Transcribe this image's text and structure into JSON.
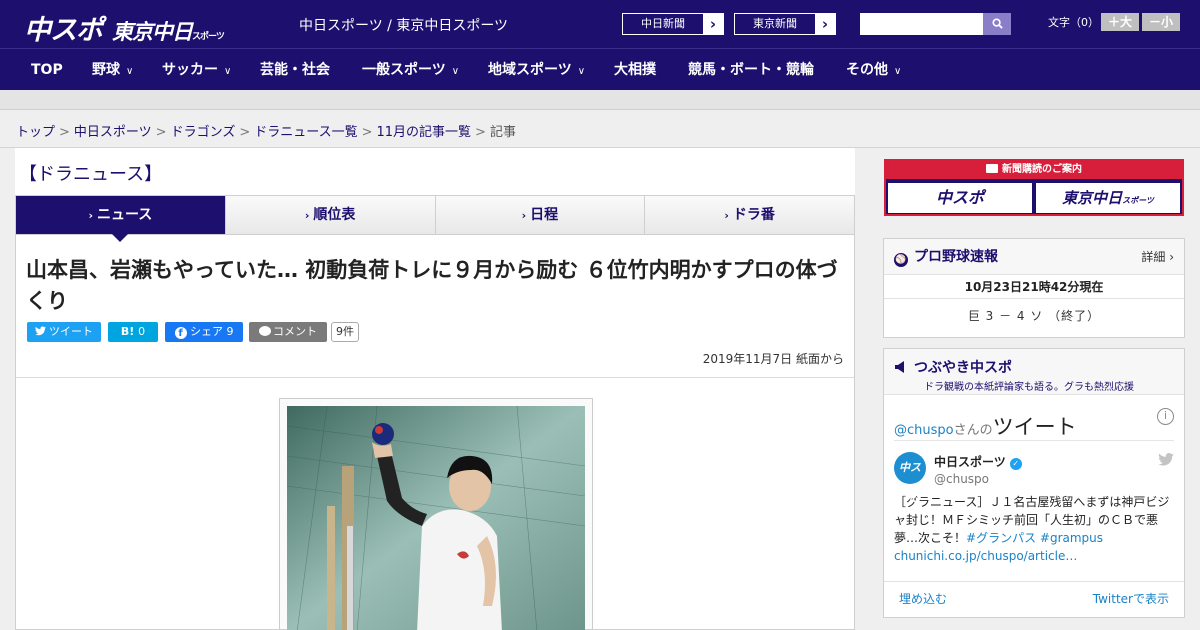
{
  "header": {
    "logo_main": "中スポ",
    "logo_sub": "東京中日",
    "logo_sub_small": "スポーツ",
    "site_title": "中日スポーツ / 東京中日スポーツ",
    "paper_buttons": [
      {
        "label": "中日新聞",
        "arrow": "›"
      },
      {
        "label": "東京新聞",
        "arrow": "›"
      }
    ],
    "search": {
      "placeholder": "",
      "icon": "search-icon"
    },
    "font_size_label": "文字（0）",
    "font_larger": "＋大",
    "font_smaller": "－小"
  },
  "nav": {
    "items": [
      {
        "label": "TOP",
        "chevron": ""
      },
      {
        "label": "野球",
        "chevron": "∨"
      },
      {
        "label": "サッカー",
        "chevron": "∨"
      },
      {
        "label": "芸能・社会",
        "chevron": ""
      },
      {
        "label": "一般スポーツ",
        "chevron": "∨"
      },
      {
        "label": "地域スポーツ",
        "chevron": "∨"
      },
      {
        "label": "大相撲",
        "chevron": ""
      },
      {
        "label": "競馬・ボート・競輪",
        "chevron": ""
      },
      {
        "label": "その他",
        "chevron": "∨"
      }
    ]
  },
  "breadcrumb": {
    "items": [
      "トップ",
      "中日スポーツ",
      "ドラゴンズ",
      "ドラニュース一覧",
      "11月の記事一覧"
    ],
    "current": "記事",
    "separator": ">"
  },
  "main": {
    "section_heading": "【ドラニュース】",
    "tabs": [
      {
        "label": "ニュース",
        "caret": "›"
      },
      {
        "label": "順位表",
        "caret": "›"
      },
      {
        "label": "日程",
        "caret": "›"
      },
      {
        "label": "ドラ番",
        "caret": "›"
      }
    ],
    "headline": "山本昌、岩瀬もやっていた… 初動負荷トレに９月から励む ６位竹内明かすプロの体づくり",
    "share": {
      "tweet": "ツイート",
      "hatena": "B!",
      "hatena_count": "0",
      "facebook": "シェア",
      "facebook_count": "9",
      "comment": "コメント",
      "comment_count": "9件"
    },
    "date": "2019年11月7日 紙面から"
  },
  "sidebar": {
    "ad": {
      "title": "新聞購読のご案内",
      "left": "中スポ",
      "right": "東京中日",
      "right_small": "スポーツ"
    },
    "baseball": {
      "title": "プロ野球速報",
      "details": "詳細 ›",
      "timestamp": "10月23日21時42分現在",
      "score": "巨 3 － 4 ソ （終了）"
    },
    "tweets": {
      "title": "つぶやき中スポ",
      "subtitle": "ドラ観戦の本紙評論家も語る。グラも熱烈応援",
      "handle_prefix": "@chuspo",
      "handle_suffix": "さんの",
      "word": "ツイート",
      "info": "i",
      "user_name": "中日スポーツ",
      "user_handle": "@chuspo",
      "avatar_text": "中スポ",
      "text": "［グラニュース］Ｊ１名古屋残留へまずは神戸ビジャ封じ！ＭＦシミッチ前回「人生初」のＣＢで悪夢…次こそ！",
      "tag1": "#グランパス",
      "tag2": "#grampus",
      "link": "chunichi.co.jp/chuspo/article…",
      "embed": "埋め込む",
      "view_on": "Twitterで表示"
    }
  },
  "colors": {
    "brand": "#1d0f6e",
    "ad_red": "#d71e3a",
    "twitter_blue": "#1da1f2",
    "facebook_blue": "#1877f2",
    "hatena_blue": "#00a4de",
    "comment_gray": "#7a7a7a"
  }
}
